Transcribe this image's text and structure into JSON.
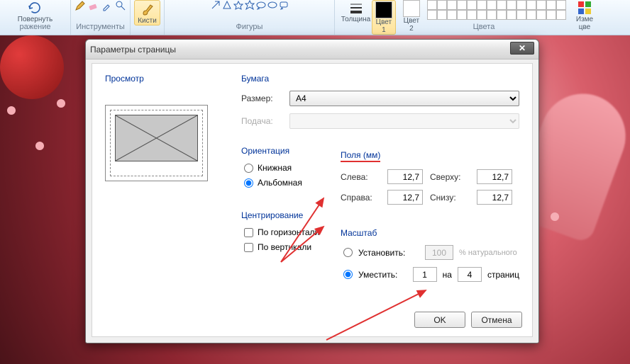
{
  "ribbon": {
    "rotate": "Повернуть",
    "group_image": "ражение",
    "group_tools": "Инструменты",
    "brushes": "Кисти",
    "group_shapes": "Фигуры",
    "thickness": "Толщина",
    "color1": "Цвет\n1",
    "color2": "Цвет\n2",
    "group_colors": "Цвета",
    "edit_colors": "Изме\nцве"
  },
  "dialog": {
    "title": "Параметры страницы",
    "preview": "Просмотр",
    "paper": "Бумага",
    "size_label": "Размер:",
    "size_value": "A4",
    "feed_label": "Подача:",
    "orientation": "Ориентация",
    "portrait": "Книжная",
    "landscape": "Альбомная",
    "margins": "Поля (мм)",
    "left": "Слева:",
    "right": "Справа:",
    "top": "Сверху:",
    "bottom": "Снизу:",
    "m_left": "12,7",
    "m_right": "12,7",
    "m_top": "12,7",
    "m_bottom": "12,7",
    "centering": "Центрирование",
    "horiz": "По горизонтали",
    "vert": "По вертикали",
    "scale": "Масштаб",
    "set": "Установить:",
    "set_val": "100",
    "set_unit": "% натурального",
    "fit": "Уместить:",
    "fit_w": "1",
    "fit_by": "на",
    "fit_h": "4",
    "fit_pages": "страниц",
    "ok": "OK",
    "cancel": "Отмена"
  }
}
